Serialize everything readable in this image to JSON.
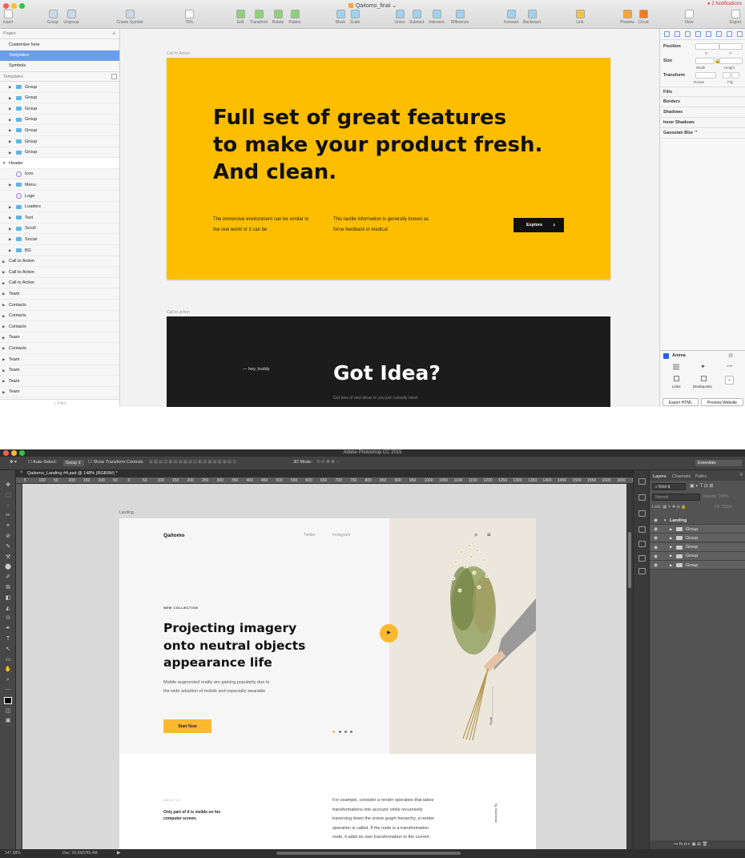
{
  "sketch": {
    "window_title": "Qaitomo_final",
    "notifications": "2 Notifications",
    "toolbar": [
      {
        "id": "insert",
        "label": "Insert",
        "icon": "plus-icon"
      },
      {
        "id": "group",
        "label": "Group",
        "icon": "group-icon"
      },
      {
        "id": "ungroup",
        "label": "Ungroup",
        "icon": "ungroup-icon"
      },
      {
        "id": "create-symbol",
        "label": "Create Symbol",
        "icon": "symbol-icon"
      },
      {
        "id": "zoom",
        "label": "76%",
        "icon": "magnifier-icon"
      },
      {
        "id": "edit",
        "label": "Edit",
        "icon": "edit-icon"
      },
      {
        "id": "transform",
        "label": "Transform",
        "icon": "transform-icon"
      },
      {
        "id": "rotate",
        "label": "Rotate",
        "icon": "rotate-icon"
      },
      {
        "id": "flatten",
        "label": "Flatten",
        "icon": "flatten-icon"
      },
      {
        "id": "mask",
        "label": "Mask",
        "icon": "mask-icon"
      },
      {
        "id": "scale",
        "label": "Scale",
        "icon": "scale-icon"
      },
      {
        "id": "union",
        "label": "Union",
        "icon": "union-icon"
      },
      {
        "id": "subtract",
        "label": "Subtract",
        "icon": "subtract-icon"
      },
      {
        "id": "intersect",
        "label": "Intersect",
        "icon": "intersect-icon"
      },
      {
        "id": "difference",
        "label": "Difference",
        "icon": "difference-icon"
      },
      {
        "id": "forward",
        "label": "Forward",
        "icon": "forward-icon"
      },
      {
        "id": "backward",
        "label": "Backward",
        "icon": "backward-icon"
      },
      {
        "id": "link",
        "label": "Link",
        "icon": "link-icon"
      },
      {
        "id": "preview",
        "label": "Preview",
        "icon": "play-icon"
      },
      {
        "id": "cloud",
        "label": "Cloud",
        "icon": "cloud-icon"
      },
      {
        "id": "view",
        "label": "View",
        "icon": "view-icon"
      },
      {
        "id": "export",
        "label": "Export",
        "icon": "export-icon"
      }
    ],
    "pages_header": "Pages",
    "pages": [
      "Customize here",
      "Templates",
      "Symbols"
    ],
    "selected_page": "Templates",
    "templates_header": "Templates",
    "layers": [
      {
        "name": "Group",
        "type": "folder",
        "indent": 1
      },
      {
        "name": "Group",
        "type": "folder",
        "indent": 1
      },
      {
        "name": "Group",
        "type": "folder",
        "indent": 1
      },
      {
        "name": "Group",
        "type": "folder",
        "indent": 1
      },
      {
        "name": "Group",
        "type": "folder",
        "indent": 1
      },
      {
        "name": "Group",
        "type": "folder",
        "indent": 1
      },
      {
        "name": "Group",
        "type": "folder",
        "indent": 1
      },
      {
        "name": "Header",
        "type": "artboard-open",
        "indent": 0
      },
      {
        "name": "Icon",
        "type": "symbol",
        "indent": 1
      },
      {
        "name": "Menu",
        "type": "folder",
        "indent": 1
      },
      {
        "name": "Logo",
        "type": "symbol",
        "indent": 1
      },
      {
        "name": "Loaders",
        "type": "folder",
        "indent": 1
      },
      {
        "name": "Text",
        "type": "folder",
        "indent": 1
      },
      {
        "name": "Scroll",
        "type": "folder",
        "indent": 1
      },
      {
        "name": "Social",
        "type": "folder",
        "indent": 1
      },
      {
        "name": "BG",
        "type": "folder",
        "indent": 1
      },
      {
        "name": "Call to Action",
        "type": "artboard",
        "indent": 0
      },
      {
        "name": "Call to Action",
        "type": "artboard",
        "indent": 0
      },
      {
        "name": "Call to Action",
        "type": "artboard",
        "indent": 0
      },
      {
        "name": "Team",
        "type": "artboard",
        "indent": 0
      },
      {
        "name": "Contacts",
        "type": "artboard",
        "indent": 0
      },
      {
        "name": "Contacts",
        "type": "artboard",
        "indent": 0
      },
      {
        "name": "Contacts",
        "type": "artboard",
        "indent": 0
      },
      {
        "name": "Team",
        "type": "artboard",
        "indent": 0
      },
      {
        "name": "Contacts",
        "type": "artboard",
        "indent": 0
      },
      {
        "name": "Team",
        "type": "artboard",
        "indent": 0
      },
      {
        "name": "Team",
        "type": "artboard",
        "indent": 0
      },
      {
        "name": "Team",
        "type": "artboard",
        "indent": 0
      },
      {
        "name": "Team",
        "type": "artboard",
        "indent": 0
      }
    ],
    "filter_placeholder": "Filter",
    "canvas": {
      "artboard1_label": "Call to Action",
      "hero": [
        "Full set of great features",
        "to make your product fresh.",
        "And clean."
      ],
      "para1": "The immersive environment can be similar to the real world or it can be",
      "para2": "This tactile information is generally known as force feedback in medical",
      "explore_label": "Explore",
      "artboard2_label": "Call to action",
      "hey_buddy": "— hey, buddy",
      "got_idea": "Got Idea?",
      "got_idea_sub": "Got tons of new ideas or you just curiosity mind."
    },
    "inspector": {
      "position": "Position",
      "x": "X",
      "y": "Y",
      "size": "Size",
      "width": "Width",
      "height": "Height",
      "transform": "Transform",
      "rotate": "Rotate",
      "flip": "Flip",
      "fills": "Fills",
      "borders": "Borders",
      "shadows": "Shadows",
      "inner_shadows": "Inner Shadows",
      "gaussian_blur": "Gaussian Blur",
      "anima": "Anima",
      "links": "Links",
      "breakpoints": "Breakpoints",
      "export_html": "Export HTML",
      "preview_website": "Preview Website"
    },
    "colors": {
      "accent_yellow": "#fdbe00",
      "selection_blue": "#6a9ee8"
    }
  },
  "photoshop": {
    "window_title": "Adobe Photoshop CC 2015",
    "auto_select": "Auto-Select:",
    "auto_select_value": "Group",
    "show_transform": "Show Transform Controls",
    "mode_3d": "3D Mode:",
    "workspace": "Essentials",
    "tab": "Qaitomo_Landing #4.psd @ 148% (RGB/8#) *",
    "ruler": [
      "5",
      "100",
      "50",
      "200",
      "150",
      "100",
      "50",
      "0",
      "50",
      "100",
      "150",
      "200",
      "250",
      "300",
      "350",
      "400",
      "450",
      "500",
      "550",
      "600",
      "650",
      "700",
      "750",
      "800",
      "850",
      "900",
      "950",
      "1000",
      "1050",
      "1100",
      "1150",
      "1200",
      "1250",
      "1300",
      "1350",
      "1400",
      "1450",
      "1500",
      "1550",
      "1600",
      "1650",
      "1700"
    ],
    "status_zoom": "147,58%",
    "status_doc": "Doc: 20,6M/245,4M",
    "panel_tabs": [
      "Layers",
      "Channels",
      "Paths"
    ],
    "kind": "Kind",
    "blend_mode": "Normal",
    "opacity": "Opacity: 100%",
    "lock": "Lock:",
    "fill": "Fill: 100%",
    "layers": [
      {
        "name": "Landing",
        "type": "artboard"
      },
      {
        "name": "Group",
        "type": "group"
      },
      {
        "name": "Group",
        "type": "group"
      },
      {
        "name": "Group",
        "type": "group"
      },
      {
        "name": "Group",
        "type": "group"
      },
      {
        "name": "Group",
        "type": "group"
      }
    ],
    "landing": {
      "label": "Landing",
      "logo": "Qaitomo",
      "nav": [
        "Twitter",
        "Instagram"
      ],
      "eyebrow": "NEW COLLECTION",
      "headline": [
        "Projecting imagery",
        "onto neutral objects",
        "appearance life"
      ],
      "body": [
        "Mobile augmented reality are gaining popularity due to",
        "the wide adoption of mobile and especially wearable"
      ],
      "cta": "Start Now",
      "scroll_label": "Scroll",
      "about_label": "ABOUT US",
      "about_title": [
        "Only part of it is visible on his",
        "computer screen."
      ],
      "about_body": [
        "For example, consider a render operation that takes",
        "transformations into account: while recursively",
        "traversing down the scene graph hierarchy, a render",
        "operation is called. If the node is a transformation",
        "node, it adds its own transformation to the current"
      ],
      "byline": "By Sisali team"
    },
    "colors": {
      "cta_yellow": "#fbb931"
    }
  }
}
